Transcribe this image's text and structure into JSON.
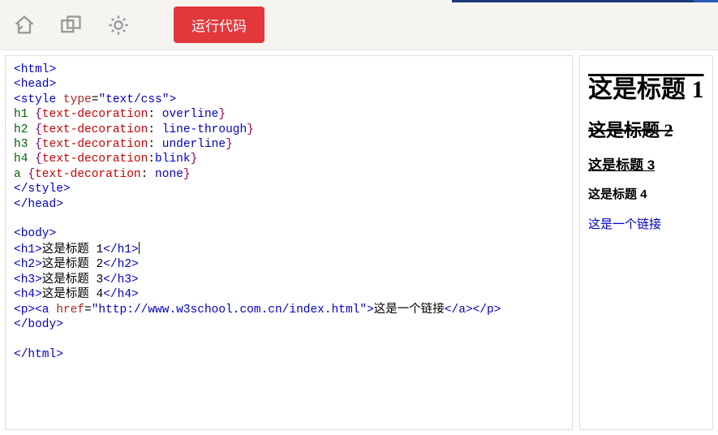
{
  "toolbar": {
    "run_label": "运行代码"
  },
  "code": {
    "l01a": "<html>",
    "l02a": "<head>",
    "l03a": "<style",
    "l03b": " type",
    "l03c": "=",
    "l03d": "\"text/css\"",
    "l03e": ">",
    "l04a": "h1 ",
    "l04b": "{",
    "l04c": "text-decoration",
    "l04d": ": ",
    "l04e": "overline",
    "l04f": "}",
    "l05a": "h2 ",
    "l05b": "{",
    "l05c": "text-decoration",
    "l05d": ": ",
    "l05e": "line-through",
    "l05f": "}",
    "l06a": "h3 ",
    "l06b": "{",
    "l06c": "text-decoration",
    "l06d": ": ",
    "l06e": "underline",
    "l06f": "}",
    "l07a": "h4 ",
    "l07b": "{",
    "l07c": "text-decoration",
    "l07d": ":",
    "l07e": "blink",
    "l07f": "}",
    "l08a": "a ",
    "l08b": "{",
    "l08c": "text-decoration",
    "l08d": ": ",
    "l08e": "none",
    "l08f": "}",
    "l09a": "</style>",
    "l10a": "</head>",
    "l11blank": "",
    "l12a": "<body>",
    "l13a": "<h1>",
    "l13b": "这是标题 1",
    "l13c": "</h1>",
    "l14a": "<h2>",
    "l14b": "这是标题 2",
    "l14c": "</h2>",
    "l15a": "<h3>",
    "l15b": "这是标题 3",
    "l15c": "</h3>",
    "l16a": "<h4>",
    "l16b": "这是标题 4",
    "l16c": "</h4>",
    "l17a": "<p><a",
    "l17b": " href",
    "l17c": "=",
    "l17d": "\"http://www.w3school.com.cn/index.html\"",
    "l17e": ">",
    "l17f": "这是一个链接",
    "l17g": "</a></p>",
    "l18a": "</body>",
    "l19blank": "",
    "l20a": "</html>"
  },
  "preview": {
    "h1": "这是标题 1",
    "h2": "这是标题 2",
    "h3": "这是标题 3",
    "h4": "这是标题 4",
    "link": "这是一个链接"
  }
}
